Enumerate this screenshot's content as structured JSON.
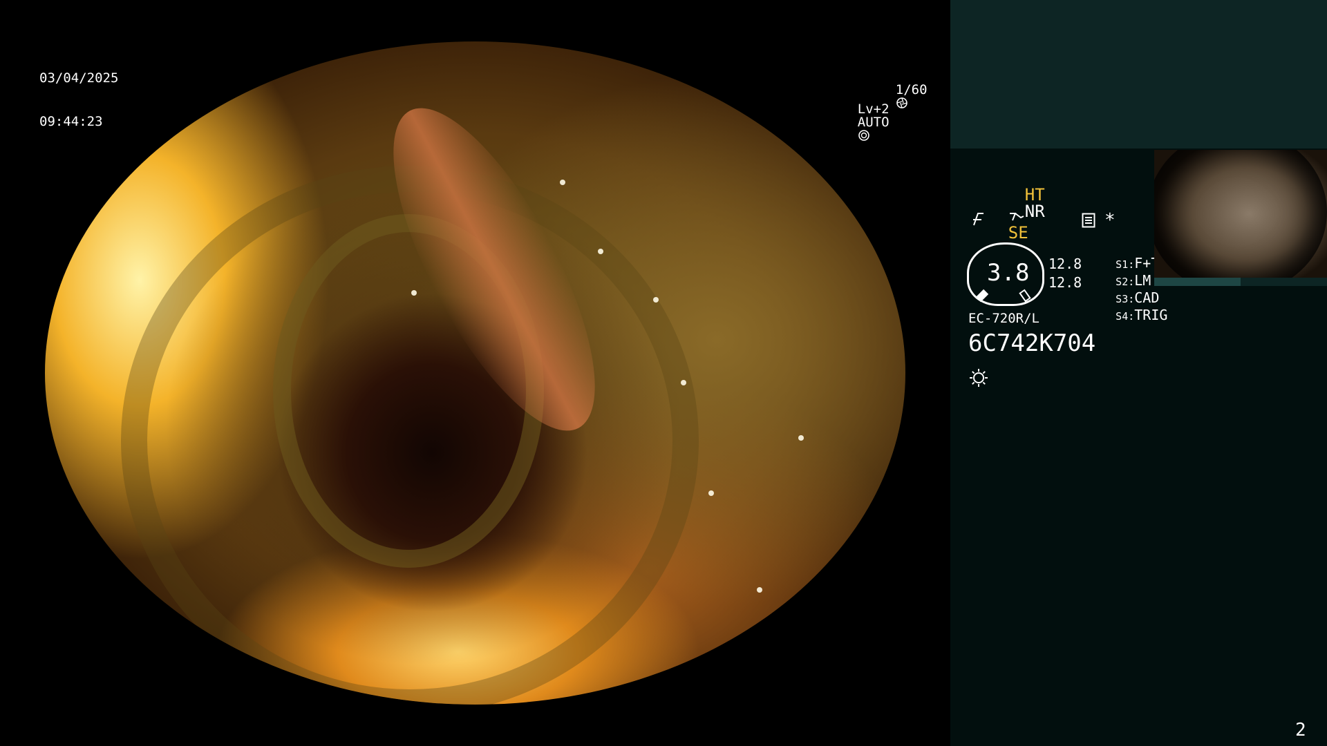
{
  "overlay": {
    "date": "03/04/2025",
    "time": "09:44:23",
    "shutter": "1/60",
    "level": "Lv+2",
    "mode": "AUTO"
  },
  "panel": {
    "ht": "HT",
    "nr": "NR",
    "se": "SE",
    "gauge_value": "3.8",
    "value_a": "12.8",
    "value_b": "12.8",
    "switches": [
      {
        "key": "S1:",
        "label": "F+T"
      },
      {
        "key": "S2:",
        "label": "LM"
      },
      {
        "key": "S3:",
        "label": "CAD"
      },
      {
        "key": "S4:",
        "label": "TRIG"
      }
    ],
    "scope_model": "EC-720R/L",
    "serial": "6C742K704",
    "page_number": "2"
  },
  "icons": {
    "shutter": "aperture-icon",
    "auto": "auto-exposure-icon",
    "structure": "structure-enhance-icon",
    "freeze": "freeze-icon",
    "memo": "memo-icon",
    "asterisk": "asterisk-icon",
    "light": "light-source-icon"
  },
  "colors": {
    "panel_bg": "#020f0e",
    "panel_top": "#0d2524",
    "accent_yellow": "#f2c23a"
  }
}
